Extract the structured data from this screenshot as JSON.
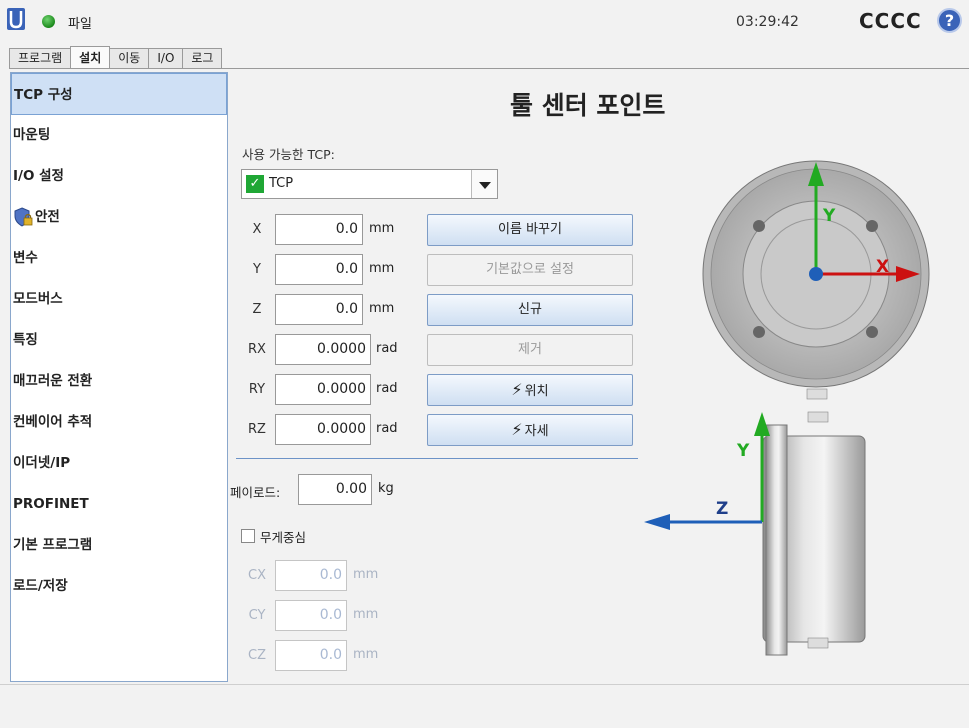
{
  "header": {
    "file_menu": "파일",
    "time": "03:29:42",
    "robot_name": "CCCC",
    "help_icon_label": "?"
  },
  "tabs": [
    {
      "label": "프로그램",
      "active": false
    },
    {
      "label": "설치",
      "active": true
    },
    {
      "label": "이동",
      "active": false
    },
    {
      "label": "I/O",
      "active": false
    },
    {
      "label": "로그",
      "active": false
    }
  ],
  "sidebar": {
    "items": [
      {
        "label": "TCP 구성",
        "selected": true
      },
      {
        "label": "마운팅"
      },
      {
        "label": "I/O 설정"
      },
      {
        "label": "안전",
        "icon": "shield-lock-icon"
      },
      {
        "label": "변수"
      },
      {
        "label": "모드버스"
      },
      {
        "label": "특징"
      },
      {
        "label": "매끄러운 전환"
      },
      {
        "label": "컨베이어 추적"
      },
      {
        "label": "이더넷/IP"
      },
      {
        "label": "PROFINET"
      },
      {
        "label": "기본 프로그램"
      },
      {
        "label": "로드/저장"
      }
    ]
  },
  "main": {
    "title": "툴 센터 포인트",
    "available_tcp_label": "사용 가능한 TCP:",
    "selected_tcp": "TCP",
    "check_glyph": "✓",
    "coords": [
      {
        "label": "X",
        "value": "0.0",
        "unit": "mm"
      },
      {
        "label": "Y",
        "value": "0.0",
        "unit": "mm"
      },
      {
        "label": "Z",
        "value": "0.0",
        "unit": "mm"
      },
      {
        "label": "RX",
        "value": "0.0000",
        "unit": "rad"
      },
      {
        "label": "RY",
        "value": "0.0000",
        "unit": "rad"
      },
      {
        "label": "RZ",
        "value": "0.0000",
        "unit": "rad"
      }
    ],
    "buttons": {
      "rename": "이름 바꾸기",
      "set_default": "기본값으로 설정",
      "new": "신규",
      "remove": "제거",
      "position": "위치",
      "orientation": "자세"
    },
    "payload_label": "페이로드:",
    "payload_value": "0.00",
    "payload_unit": "kg",
    "cog_label": "무게중심",
    "cog": [
      {
        "label": "CX",
        "value": "0.0",
        "unit": "mm"
      },
      {
        "label": "CY",
        "value": "0.0",
        "unit": "mm"
      },
      {
        "label": "CZ",
        "value": "0.0",
        "unit": "mm"
      }
    ]
  },
  "drawing": {
    "top_view_axes": {
      "y": "Y",
      "x": "X"
    },
    "side_view_axes": {
      "y": "Y",
      "z": "Z"
    },
    "colors": {
      "y_axis": "#22aa22",
      "x_axis": "#cc1111",
      "z_axis": "#1f5fb8",
      "origin": "#1f5fb8"
    }
  }
}
